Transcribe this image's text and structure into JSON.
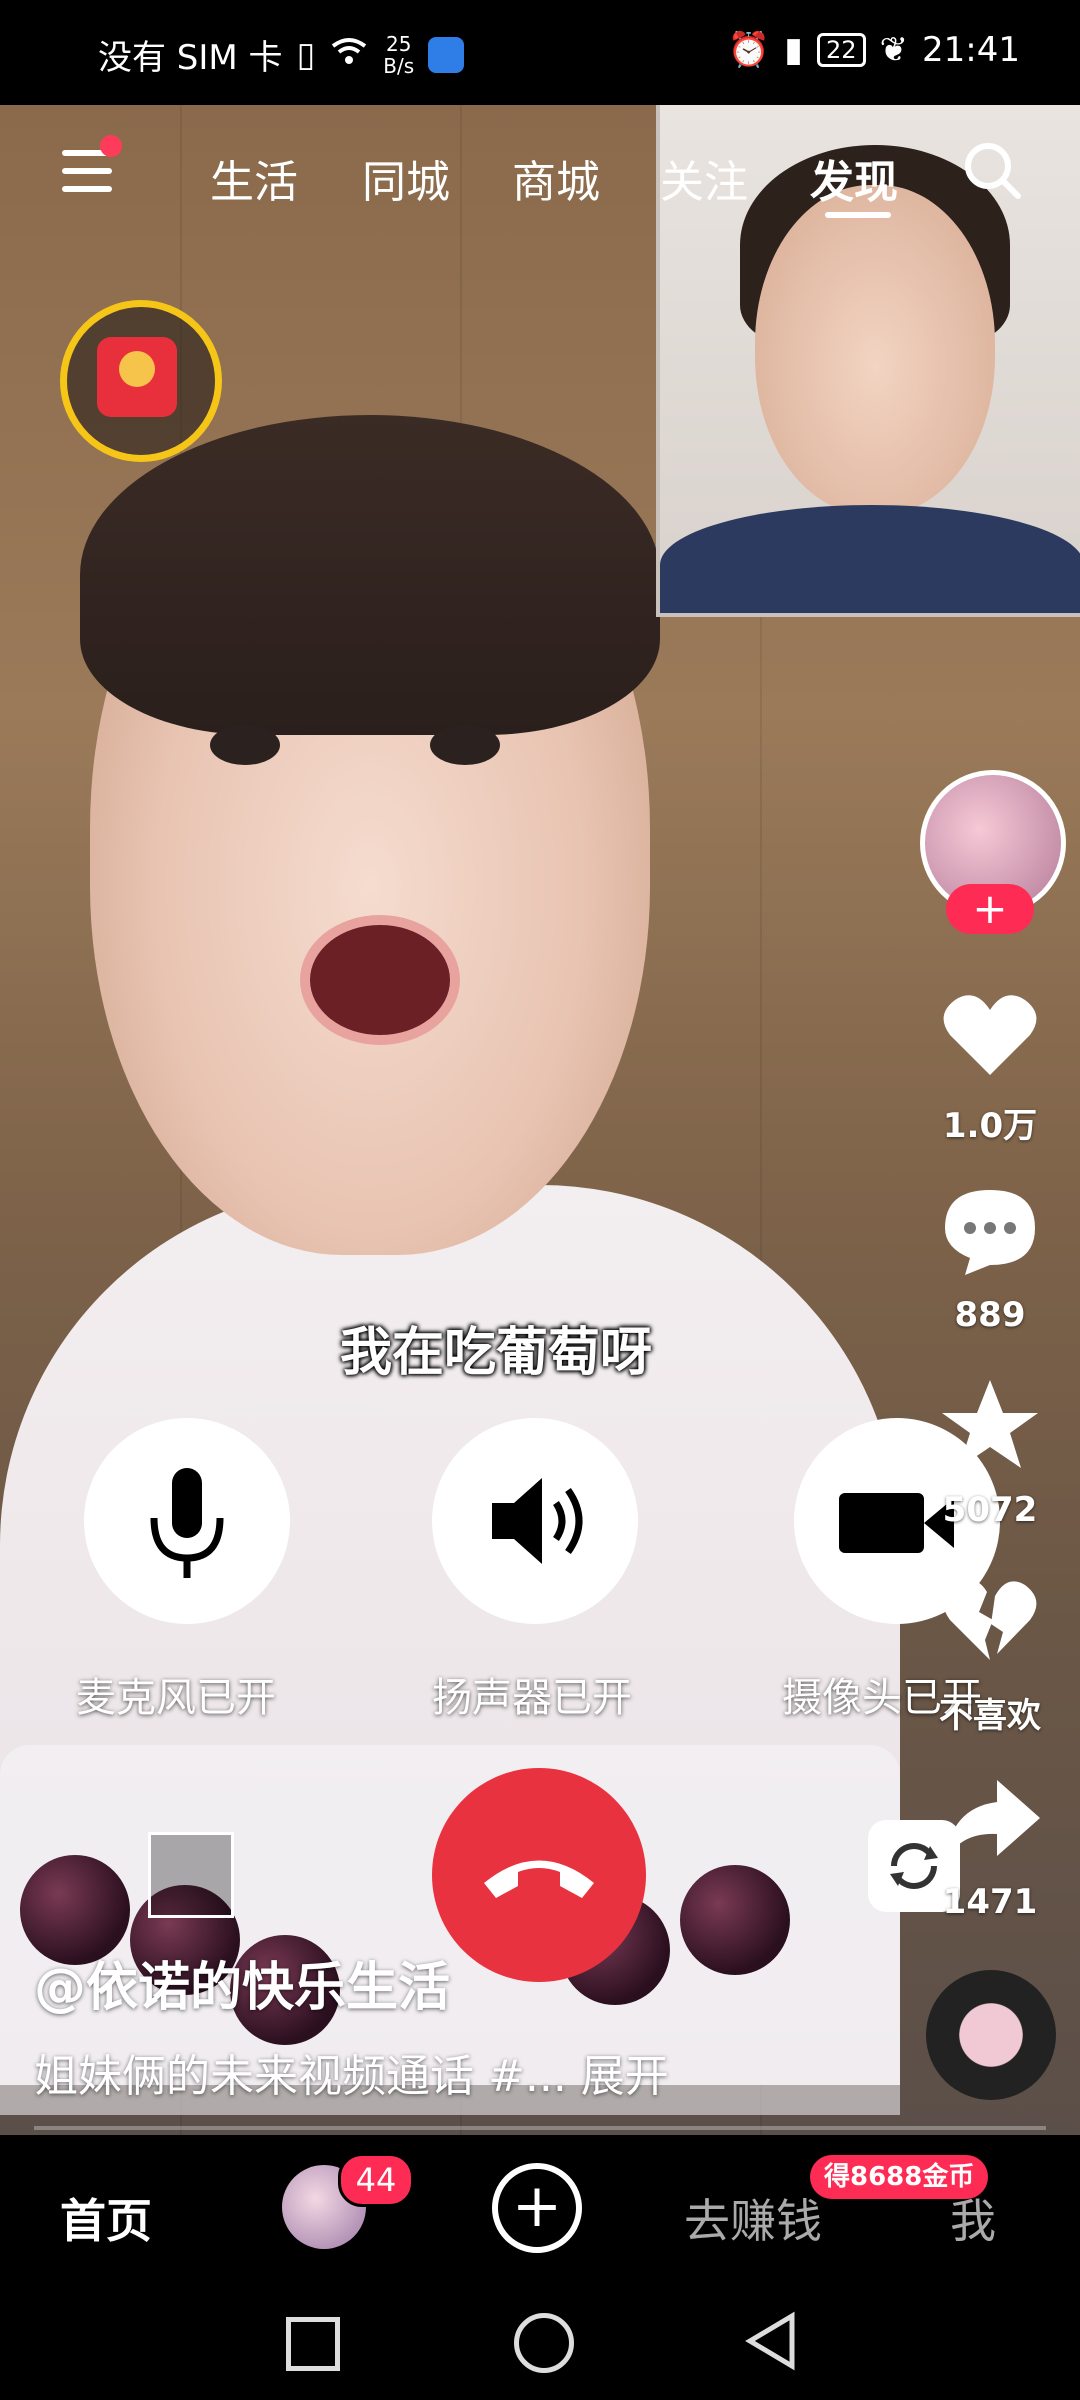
{
  "status_bar": {
    "carrier": "没有 SIM 卡",
    "net_speed_value": "25",
    "net_speed_unit": "B/s",
    "battery": "22",
    "time": "21:41",
    "icons": [
      "sim-alert-icon",
      "wifi-icon",
      "browser-app-icon",
      "alarm-icon",
      "vibrate-icon",
      "battery-icon",
      "leaf-icon"
    ]
  },
  "top_nav": {
    "tabs": [
      {
        "label": "生活"
      },
      {
        "label": "同城"
      },
      {
        "label": "商城"
      },
      {
        "label": "关注"
      },
      {
        "label": "发现",
        "active": true
      }
    ]
  },
  "video": {
    "caption": "我在吃葡萄呀",
    "username": "@依诺的快乐生活",
    "description": "姐妹俩的未来视频通话 #... 展开"
  },
  "call_controls": {
    "mic_label": "麦克风已开",
    "speaker_label": "扬声器已开",
    "camera_label": "摄像头已开"
  },
  "right_rail": {
    "likes": "1.0万",
    "comments": "889",
    "favorites": "5072",
    "dislike_label": "不喜欢",
    "shares": "1471"
  },
  "tab_bar": {
    "home": "首页",
    "messages_badge": "44",
    "earn": "去赚钱",
    "earn_badge": "得8688金币",
    "me": "我"
  },
  "colors": {
    "accent": "#fe2c55",
    "hangup": "#e8323f",
    "envelope": "#e8303c",
    "envelope_ring": "#f5c518"
  }
}
